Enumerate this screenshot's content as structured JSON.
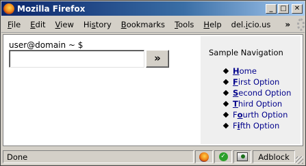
{
  "window": {
    "title": "Mozilla Firefox",
    "controls": {
      "minimize": "_",
      "maximize": "□",
      "close": "✕"
    }
  },
  "menubar": {
    "items": [
      {
        "pre": "",
        "key": "F",
        "post": "ile"
      },
      {
        "pre": "",
        "key": "E",
        "post": "dit"
      },
      {
        "pre": "",
        "key": "V",
        "post": "iew"
      },
      {
        "pre": "Hi",
        "key": "s",
        "post": "tory"
      },
      {
        "pre": "",
        "key": "B",
        "post": "ookmarks"
      },
      {
        "pre": "",
        "key": "T",
        "post": "ools"
      },
      {
        "pre": "",
        "key": "H",
        "post": "elp"
      },
      {
        "pre": "del.",
        "key": "i",
        "post": "cio.us"
      }
    ],
    "overflow_chevron": "»",
    "throbber_icon": "throbber-icon"
  },
  "terminal": {
    "prompt": "user@domain ~ $",
    "input_value": "",
    "go_button": "»"
  },
  "navigation": {
    "title": "Sample Navigation",
    "items": [
      {
        "key": "H",
        "rest": "ome"
      },
      {
        "key": "F",
        "rest": "irst Option"
      },
      {
        "key": "S",
        "rest": "econd Option"
      },
      {
        "key": "T",
        "rest": "hird Option"
      },
      {
        "pre": "F",
        "key": "o",
        "rest": "urth Option"
      },
      {
        "pre": "F",
        "key": "i",
        "rest": "fth Option"
      }
    ],
    "link_color": "#00008b"
  },
  "statusbar": {
    "text": "Done",
    "adblock": "Adblock",
    "icons": [
      "firefox-icon",
      "check-icon",
      "extension-icon"
    ]
  }
}
